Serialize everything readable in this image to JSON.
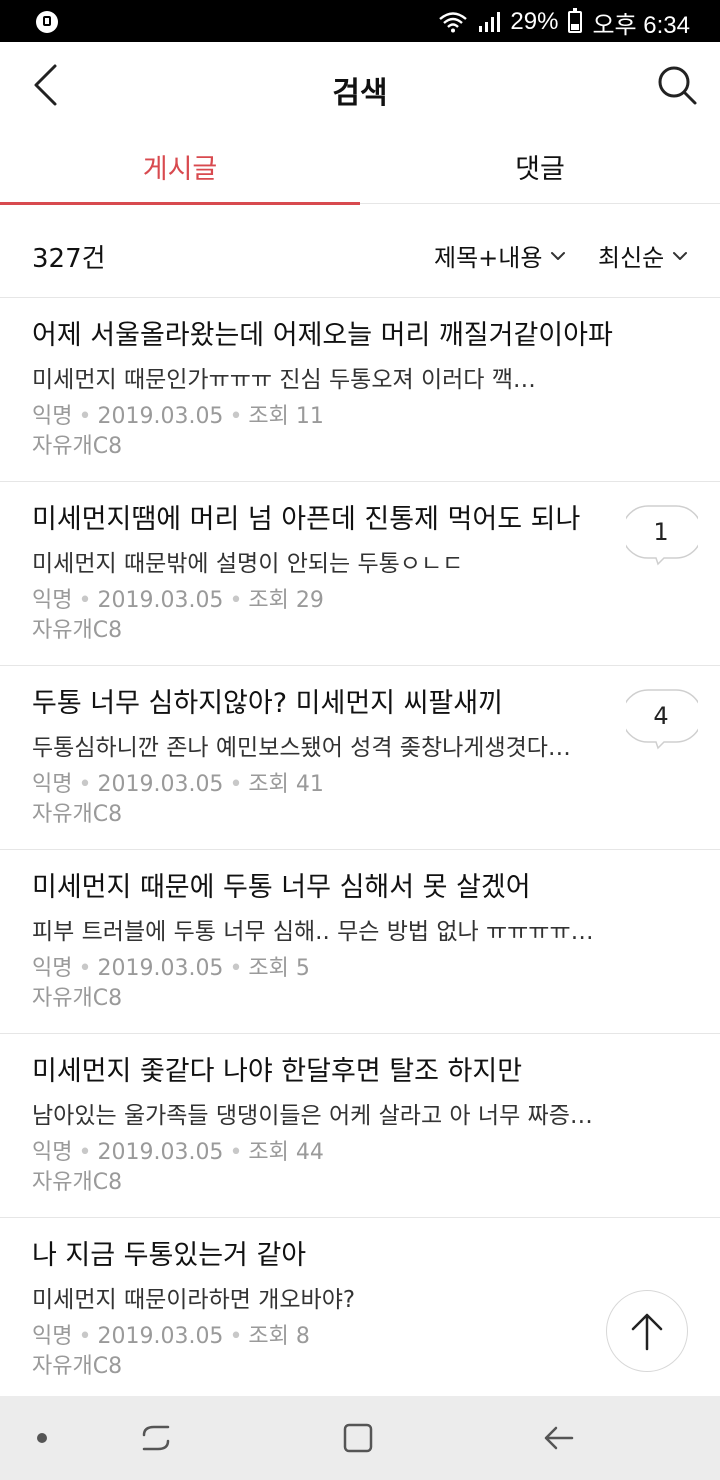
{
  "status_bar": {
    "battery": "29%",
    "time": "오후 6:34"
  },
  "header": {
    "title": "검색"
  },
  "tabs": [
    {
      "label": "게시글",
      "active": true
    },
    {
      "label": "댓글",
      "active": false
    }
  ],
  "filter": {
    "count": "327건",
    "scope": "제목+내용",
    "sort": "최신순"
  },
  "colors": {
    "accent": "#d84a4f",
    "meta": "#9a9a9a"
  },
  "posts": [
    {
      "title": "어제 서울올라왔는데 어제오늘 머리 깨질거같이아파",
      "preview": "미세먼지 때문인가ㅠㅠㅠ 진심 두통오져 이러다 깩…",
      "author": "익명",
      "date": "2019.03.05",
      "views": "조회 11",
      "board": "자유개C8",
      "comments": ""
    },
    {
      "title": "미세먼지땜에 머리 넘 아픈데 진통제 먹어도 되나",
      "preview": "미세먼지 때문밖에 설명이 안되는 두통ㅇㄴㄷ",
      "author": "익명",
      "date": "2019.03.05",
      "views": "조회 29",
      "board": "자유개C8",
      "comments": "1"
    },
    {
      "title": "두통 너무 심하지않아? 미세먼지 씨팔새끼",
      "preview": "두통심하니깐 존나 예민보스됐어 성격 좆창나게생겻다…",
      "author": "익명",
      "date": "2019.03.05",
      "views": "조회 41",
      "board": "자유개C8",
      "comments": "4"
    },
    {
      "title": "미세먼지 때문에 두통 너무 심해서 못 살겠어",
      "preview": "피부 트러블에 두통 너무 심해.. 무슨 방법 없나 ㅠㅠㅠㅠㅠ 아…",
      "author": "익명",
      "date": "2019.03.05",
      "views": "조회 5",
      "board": "자유개C8",
      "comments": ""
    },
    {
      "title": "미세먼지 좇같다 나야 한달후면 탈조 하지만",
      "preview": "남아있는 울가족들 댕댕이들은 어케 살라고 아 너무 짜증난다…",
      "author": "익명",
      "date": "2019.03.05",
      "views": "조회 44",
      "board": "자유개C8",
      "comments": ""
    },
    {
      "title": "나 지금 두통있는거 같아",
      "preview": "미세먼지 때문이라하면 개오바야?",
      "author": "익명",
      "date": "2019.03.05",
      "views": "조회 8",
      "board": "자유개C8",
      "comments": ""
    }
  ]
}
